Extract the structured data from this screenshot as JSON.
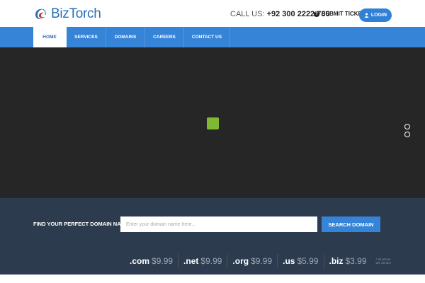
{
  "header": {
    "brand": "BizTorch",
    "call_label": "CALL US:",
    "call_number": "+92 300 2222 786",
    "submit_ticket": "SUBMIT TICKET",
    "login": "LOGIN"
  },
  "nav": {
    "items": [
      {
        "label": "HOME",
        "active": true
      },
      {
        "label": "SERVICES",
        "active": false
      },
      {
        "label": "DOMAINS",
        "active": false
      },
      {
        "label": "CAREERS",
        "active": false
      },
      {
        "label": "CONTACT US",
        "active": false
      }
    ]
  },
  "hero": {
    "loader_color": "#7fb833",
    "slide_dots": 2
  },
  "domain_search": {
    "label": "FIND YOUR PERFECT DOMAIN NAME:",
    "placeholder": "Enter your domain name here...",
    "button": "SEARCH DOMAIN",
    "prices": [
      {
        "tld": ".com",
        "price": "$9.99"
      },
      {
        "tld": ".net",
        "price": "$9.99"
      },
      {
        "tld": ".org",
        "price": "$9.99"
      },
      {
        "tld": ".us",
        "price": "$5.99"
      },
      {
        "tld": ".biz",
        "price": "$3.99"
      }
    ],
    "note_line1": "* All prices",
    "note_line2": "per annum"
  },
  "colors": {
    "brand_blue": "#3584d8",
    "hero_bg": "#262626",
    "domain_bg": "#2c3b4d"
  }
}
